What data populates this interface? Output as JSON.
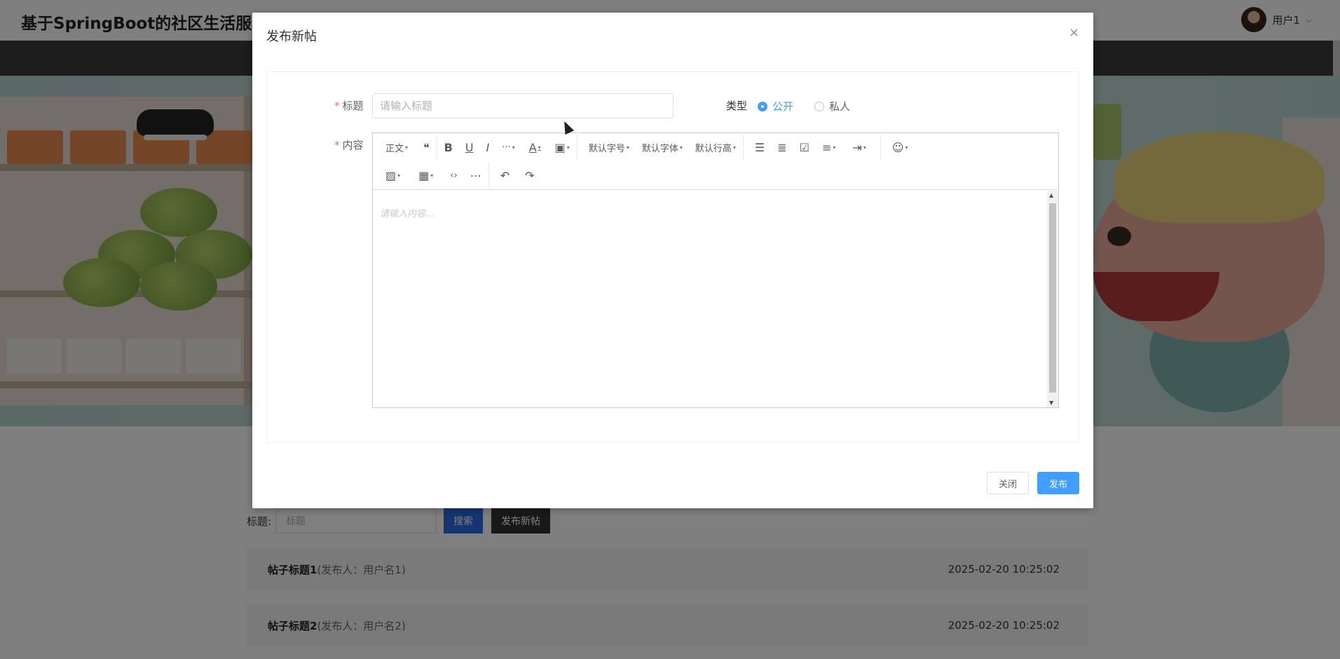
{
  "header": {
    "site_title": "基于SpringBoot的社区生活服务平台设计与实现",
    "username": "用户1"
  },
  "search": {
    "label": "标题:",
    "placeholder": "标题",
    "search_button": "搜索",
    "new_post_button": "发布新帖"
  },
  "posts": [
    {
      "title": "帖子标题1",
      "author": "(发布人：用户名1)",
      "date": "2025-02-20 10:25:02"
    },
    {
      "title": "帖子标题2",
      "author": "(发布人：用户名2)",
      "date": "2025-02-20 10:25:02"
    }
  ],
  "dialog": {
    "title": "发布新帖",
    "close_icon": "×",
    "title_label": "标题",
    "title_placeholder": "请输入标题",
    "type_label": "类型",
    "type_options": [
      "公开",
      "私人"
    ],
    "type_selected": "公开",
    "content_label": "内容",
    "content_placeholder": "请输入内容...",
    "toolbar": {
      "paragraph": "正文",
      "font_size": "默认字号",
      "font_family": "默认字体",
      "line_height": "默认行高"
    },
    "close_button": "关闭",
    "publish_button": "发布"
  },
  "colors": {
    "primary": "#409eff",
    "required": "#f56c6c",
    "nav": "#3a3a3a"
  }
}
